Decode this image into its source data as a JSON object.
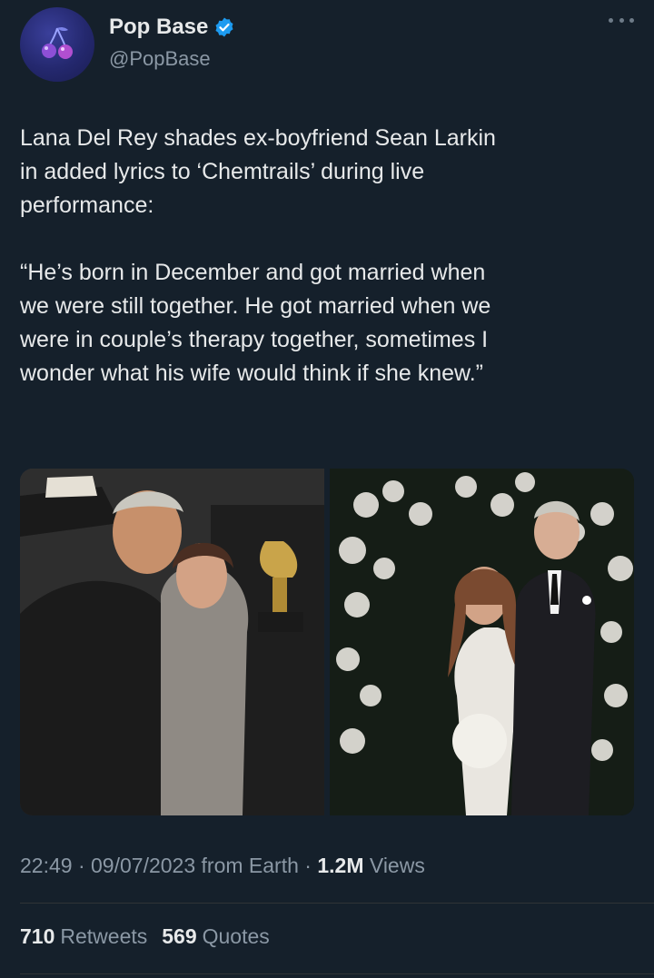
{
  "author": {
    "display_name": "Pop Base",
    "handle": "@PopBase",
    "verified": true,
    "avatar_icon": "cherry-icon"
  },
  "tweet": {
    "text": "Lana Del Rey shades ex-boyfriend Sean Larkin\nin added lyrics to ‘Chemtrails’ during live\nperformance:\n\n“He’s born in December and got married when\nwe were still together. He got married when we\nwere in couple’s therapy together, sometimes I\nwonder what his wife would think if she knew.”"
  },
  "meta": {
    "time": "22:49",
    "date": "09/07/2023",
    "source": "from Earth",
    "views_count": "1.2M",
    "views_label": "Views"
  },
  "stats": {
    "retweets_count": "710",
    "retweets_label": "Retweets",
    "quotes_count": "569",
    "quotes_label": "Quotes"
  },
  "colors": {
    "background": "#15202b",
    "verified_blue": "#1d9bf0",
    "secondary_text": "#8b98a5"
  }
}
